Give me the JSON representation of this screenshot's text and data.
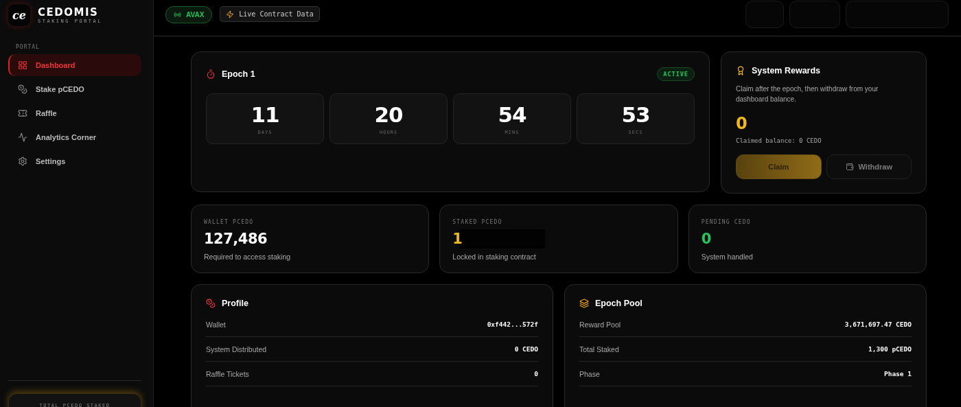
{
  "brand": {
    "name": "CEDOMIS",
    "subtitle": "STAKING PORTAL",
    "logo_text": "ce"
  },
  "sidebar": {
    "section": "PORTAL",
    "items": [
      {
        "label": "Dashboard",
        "selected": true
      },
      {
        "label": "Stake pCEDO",
        "selected": false
      },
      {
        "label": "Raffle",
        "selected": false
      },
      {
        "label": "Analytics Corner",
        "selected": false
      },
      {
        "label": "Settings",
        "selected": false
      }
    ],
    "footer_label": "TOTAL PCEDO STAKED"
  },
  "top_bar": {
    "network": "AVAX",
    "live": "Live Contract Data"
  },
  "epoch": {
    "title": "Epoch 1",
    "status": "ACTIVE",
    "countdown": [
      {
        "value": "11",
        "unit": "DAYS"
      },
      {
        "value": "20",
        "unit": "HOURS"
      },
      {
        "value": "54",
        "unit": "MINS"
      },
      {
        "value": "53",
        "unit": "SECS"
      }
    ]
  },
  "rewards": {
    "title": "System Rewards",
    "description": "Claim after the epoch, then withdraw from your dashboard balance.",
    "amount": "0",
    "claimed": "Claimed balance: 0 CEDO",
    "buttons": [
      {
        "label": "Claim",
        "kind": "primary",
        "disabled": true
      },
      {
        "label": "Withdraw",
        "kind": "secondary",
        "disabled": true
      }
    ]
  },
  "stats": [
    {
      "label": "WALLET PCEDO",
      "value": "127,486",
      "note": "Required to access staking",
      "color": "#ffffff",
      "redacted": false
    },
    {
      "label": "STAKED PCEDO",
      "value": "1",
      "note": "Locked in staking contract",
      "color": "#e8b923",
      "redacted": true
    },
    {
      "label": "PENDING CEDO",
      "value": "0",
      "note": "System handled",
      "color": "#22c55e",
      "redacted": false
    }
  ],
  "panels": [
    {
      "title": "Profile",
      "rows": [
        {
          "label": "Wallet",
          "value": "0xf442...572f"
        },
        {
          "label": "System Distributed",
          "value": "0 CEDO"
        },
        {
          "label": "Raffle Tickets",
          "value": "0"
        }
      ]
    },
    {
      "title": "Epoch Pool",
      "rows": [
        {
          "label": "Reward Pool",
          "value": "3,671,697.47 CEDO"
        },
        {
          "label": "Total Staked",
          "value": "1,300 pCEDO"
        },
        {
          "label": "Phase",
          "value": "Phase 1"
        }
      ]
    }
  ]
}
